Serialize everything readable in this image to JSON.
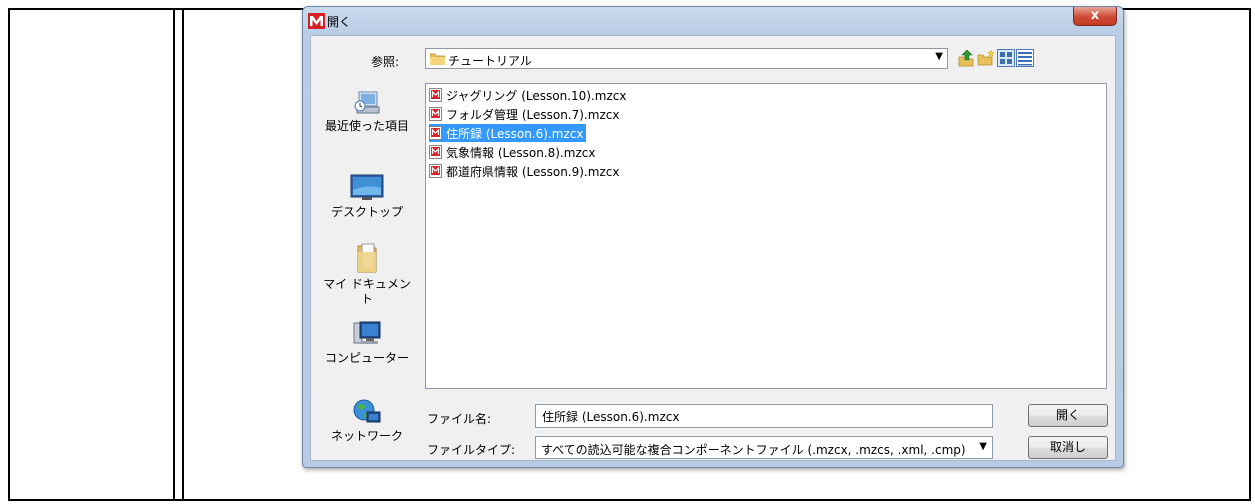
{
  "window": {
    "title": "開く",
    "close_glyph": "x"
  },
  "toolbar": {
    "lookin_label": "参照:",
    "lookin_value": "チュートリアル",
    "up_icon": "up-folder-icon",
    "new_folder_icon": "new-folder-icon",
    "list_view_icon": "list-view-icon",
    "details_view_icon": "details-view-icon"
  },
  "sidebar": {
    "items": [
      {
        "label": "最近使った項目",
        "icon": "recent-items-icon"
      },
      {
        "label": "デスクトップ",
        "icon": "desktop-icon"
      },
      {
        "label": "マイ ドキュメント",
        "icon": "documents-icon"
      },
      {
        "label": "コンピューター",
        "icon": "computer-icon"
      },
      {
        "label": "ネットワーク",
        "icon": "network-icon"
      }
    ]
  },
  "files": [
    {
      "name": "ジャグリング (Lesson.10).mzcx",
      "selected": false
    },
    {
      "name": "フォルダ管理 (Lesson.7).mzcx",
      "selected": false
    },
    {
      "name": "住所録 (Lesson.6).mzcx",
      "selected": true
    },
    {
      "name": "気象情報 (Lesson.8).mzcx",
      "selected": false
    },
    {
      "name": "都道府県情報 (Lesson.9).mzcx",
      "selected": false
    }
  ],
  "footer": {
    "filename_label": "ファイル名:",
    "filename_value": "住所録 (Lesson.6).mzcx",
    "filetype_label": "ファイルタイプ:",
    "filetype_value": "すべての読込可能な複合コンポーネントファイル (.mzcx, .mzcs, .xml, .cmp)",
    "open_button": "開く",
    "cancel_button": "取消し"
  },
  "colors": {
    "selection": "#3399ff",
    "close": "#c94a35"
  }
}
